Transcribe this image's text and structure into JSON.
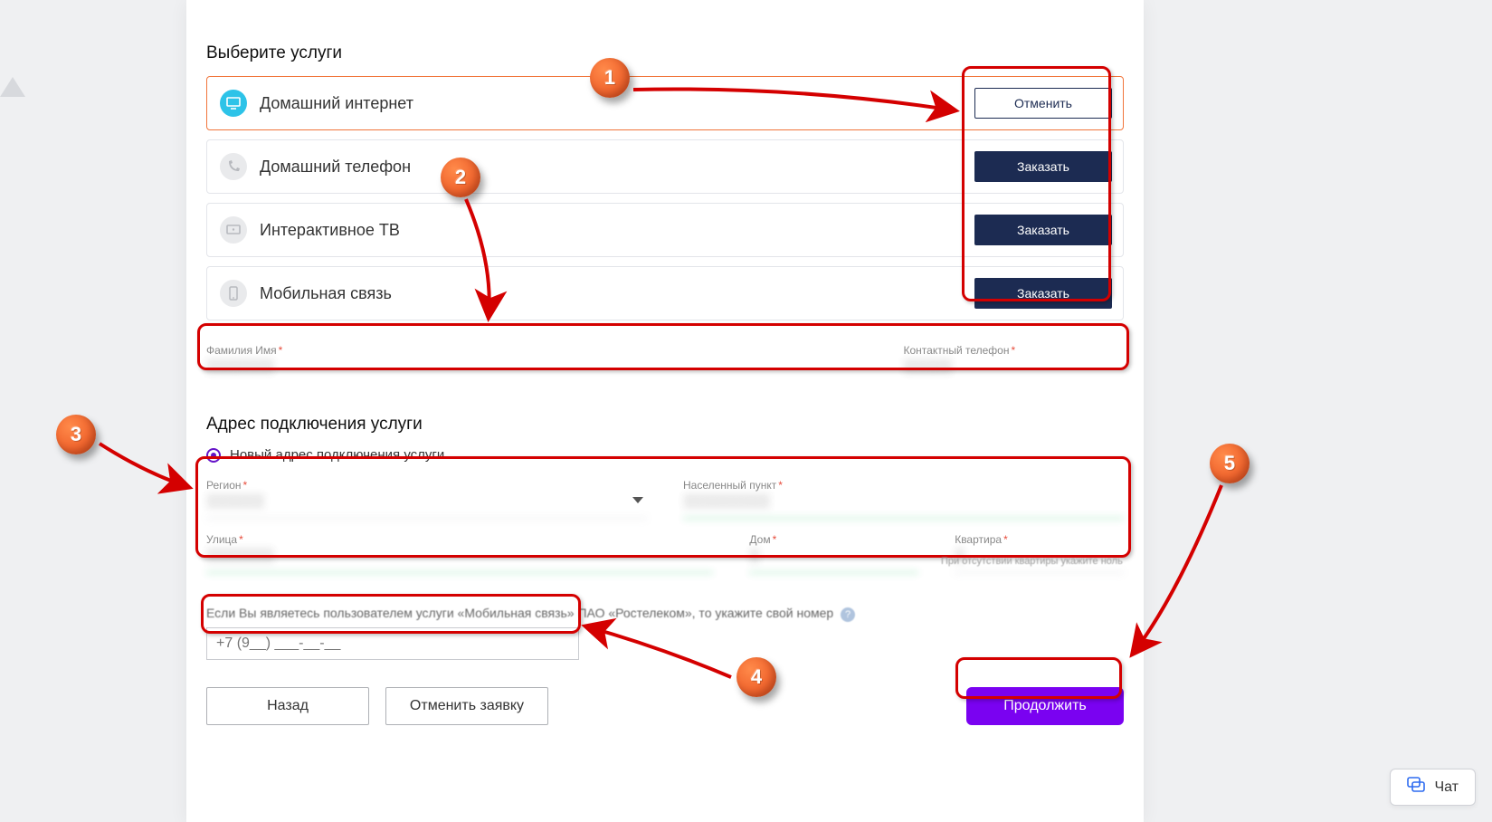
{
  "sections": {
    "select_services": "Выберите услуги",
    "address": "Адрес подключения услуги"
  },
  "services": [
    {
      "name": "Домашний интернет",
      "button": "Отменить"
    },
    {
      "name": "Домашний телефон",
      "button": "Заказать"
    },
    {
      "name": "Интерактивное ТВ",
      "button": "Заказать"
    },
    {
      "name": "Мобильная связь",
      "button": "Заказать"
    }
  ],
  "contact": {
    "name_label": "Фамилия Имя",
    "phone_label": "Контактный телефон"
  },
  "radio": {
    "new_address": "Новый адрес подключения услуги"
  },
  "addr": {
    "region": "Регион",
    "city": "Населенный пункт",
    "street": "Улица",
    "house": "Дом",
    "apt": "Квартира",
    "apt_note": "При отсутствии квартиры укажите ноль"
  },
  "mobile_note": "Если Вы являетесь пользователем услуги «Мобильная связь» ПАО «Ростелеком», то укажите свой номер",
  "phone_mask": "+7 (9__) ___-__-__",
  "buttons": {
    "back": "Назад",
    "cancel_request": "Отменить заявку",
    "continue": "Продолжить"
  },
  "chat": "Чат",
  "callouts": {
    "1": "1",
    "2": "2",
    "3": "3",
    "4": "4",
    "5": "5"
  }
}
